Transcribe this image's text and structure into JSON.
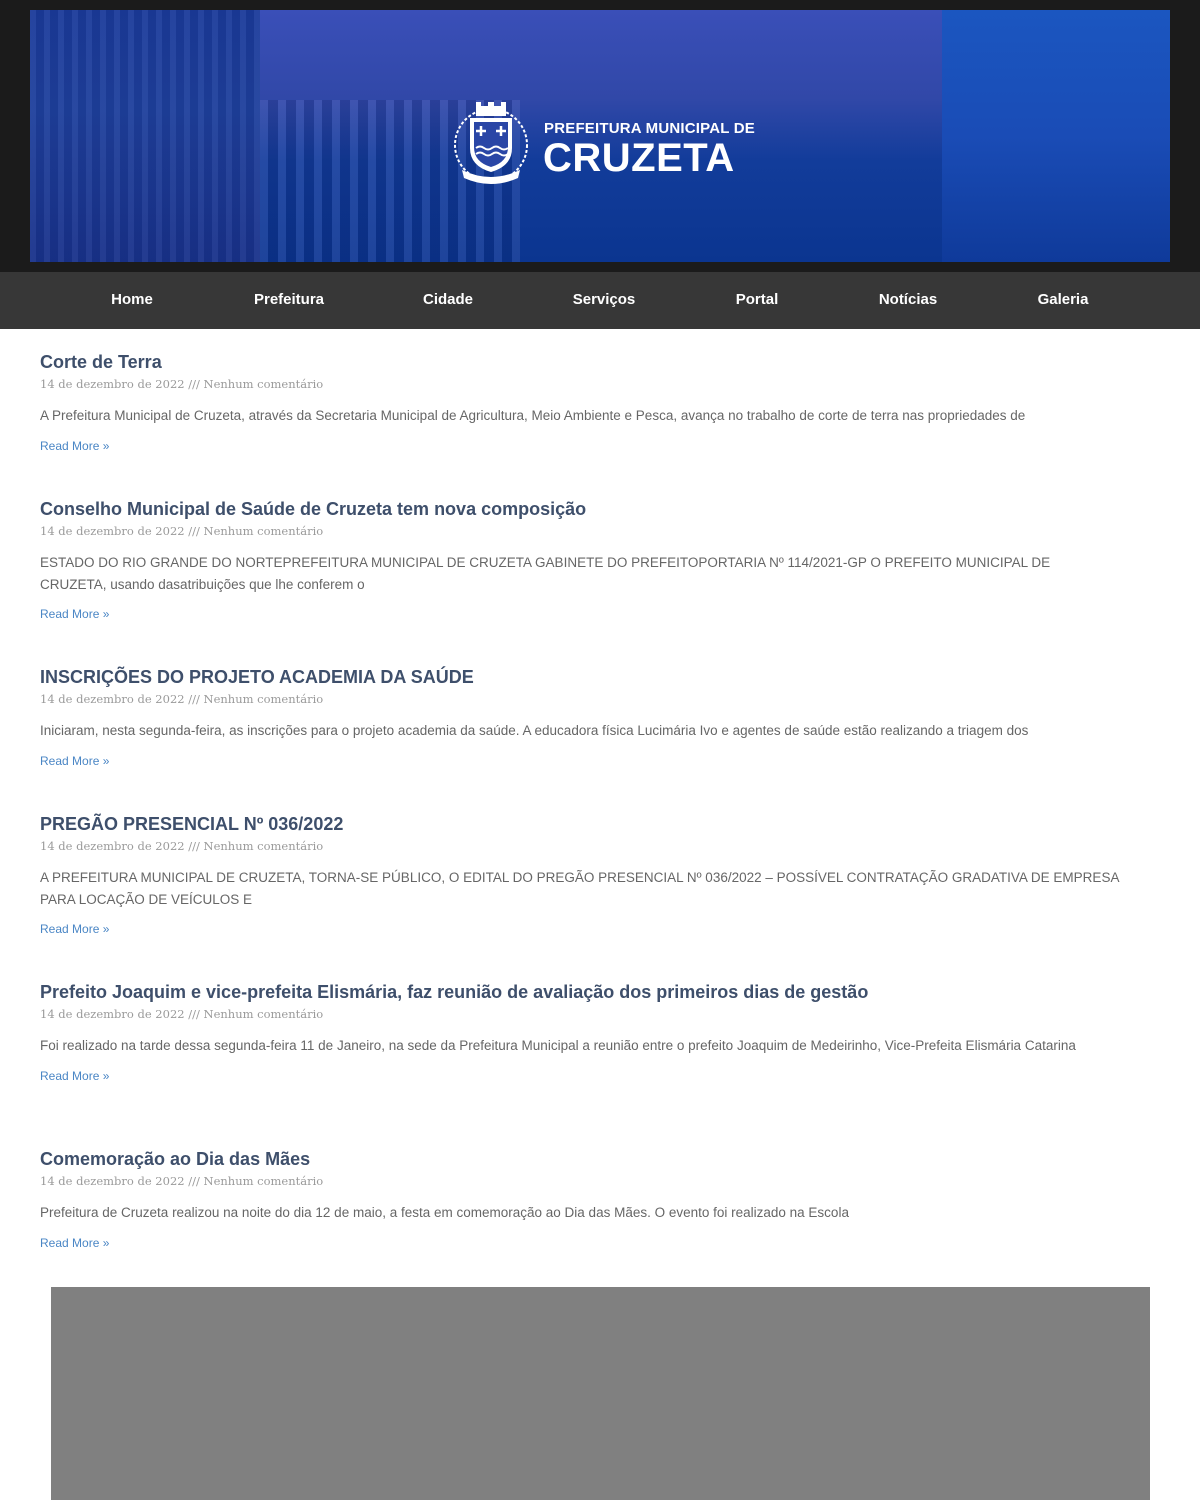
{
  "banner": {
    "logo_subtitle": "PREFEITURA MUNICIPAL DE",
    "logo_title": "CRUZETA",
    "seal_text": "CRUZETA"
  },
  "nav": {
    "items": [
      {
        "label": "Home"
      },
      {
        "label": "Prefeitura"
      },
      {
        "label": "Cidade"
      },
      {
        "label": "Serviços"
      },
      {
        "label": "Portal"
      },
      {
        "label": "Notícias"
      },
      {
        "label": "Galeria"
      }
    ]
  },
  "posts": [
    {
      "title": "Corte de Terra",
      "meta": "14 de dezembro de 2022 /// Nenhum comentário",
      "excerpt": "A Prefeitura Municipal de Cruzeta, através da Secretaria Municipal de Agricultura, Meio Ambiente e Pesca, avança no trabalho de corte de terra nas propriedades de",
      "read_more": "Read More »"
    },
    {
      "title": "Conselho Municipal de Saúde de Cruzeta tem nova composição",
      "meta": "14 de dezembro de 2022 /// Nenhum comentário",
      "excerpt": "ESTADO DO RIO GRANDE DO NORTEPREFEITURA MUNICIPAL DE CRUZETA GABINETE DO PREFEITOPORTARIA Nº 114/2021-GP O PREFEITO MUNICIPAL DE CRUZETA, usando dasatribuições que lhe conferem o",
      "read_more": "Read More »"
    },
    {
      "title": "INSCRIÇÕES DO PROJETO ACADEMIA DA SAÚDE",
      "meta": "14 de dezembro de 2022 /// Nenhum comentário",
      "excerpt": "Iniciaram, nesta segunda-feira, as inscrições para o projeto academia da saúde. A educadora física Lucimária Ivo e agentes de saúde estão realizando a triagem dos",
      "read_more": "Read More »"
    },
    {
      "title": "PREGÃO PRESENCIAL Nº 036/2022",
      "meta": "14 de dezembro de 2022 /// Nenhum comentário",
      "excerpt": "A PREFEITURA MUNICIPAL DE CRUZETA, TORNA-SE PÚBLICO, O EDITAL DO PREGÃO PRESENCIAL Nº 036/2022 – POSSÍVEL CONTRATAÇÃO GRADATIVA DE EMPRESA PARA LOCAÇÃO DE VEÍCULOS E",
      "read_more": "Read More »"
    },
    {
      "title": "Prefeito Joaquim e vice-prefeita Elismária, faz reunião de avaliação dos primeiros dias de gestão",
      "meta": "14 de dezembro de 2022 /// Nenhum comentário",
      "excerpt": "Foi realizado na tarde dessa segunda-feira 11 de Janeiro, na sede da Prefeitura Municipal a reunião entre o prefeito Joaquim de Medeirinho, Vice-Prefeita Elismária Catarina",
      "read_more": "Read More »"
    },
    {
      "title": "Comemoração ao Dia das Mães",
      "meta": "14 de dezembro de 2022 /// Nenhum comentário",
      "excerpt": "Prefeitura de Cruzeta realizou na noite do dia 12 de maio, a festa em comemoração ao Dia das Mães. O evento foi realizado na Escola",
      "read_more": "Read More »"
    }
  ]
}
